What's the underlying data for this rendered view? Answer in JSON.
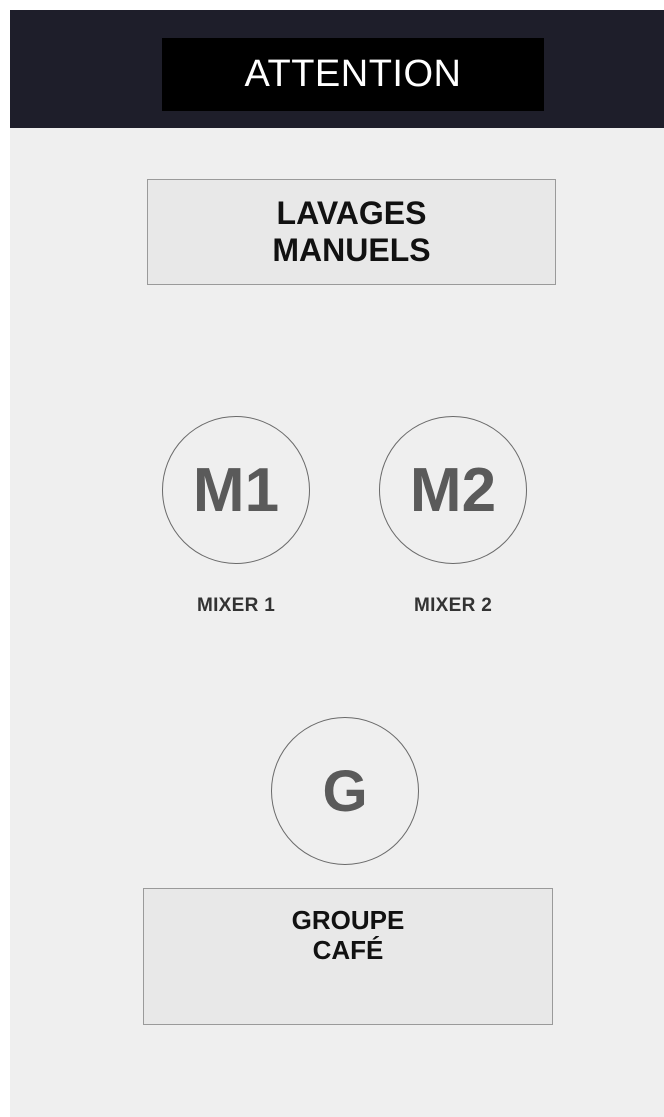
{
  "header": {
    "title": "ATTENTION",
    "background_color": "#1e1e2a"
  },
  "main": {
    "section_title": {
      "line1": "LAVAGES",
      "line2": "MANUELS"
    },
    "mixers": [
      {
        "icon_text": "M1",
        "label": "MIXER 1"
      },
      {
        "icon_text": "M2",
        "label": "MIXER 2"
      }
    ],
    "group": {
      "icon_text": "G",
      "label_line1": "GROUPE",
      "label_line2": "CAFÉ"
    }
  },
  "colors": {
    "background": "#efefef",
    "icon_gray": "#5a5a5a",
    "title_bg": "#000000"
  }
}
